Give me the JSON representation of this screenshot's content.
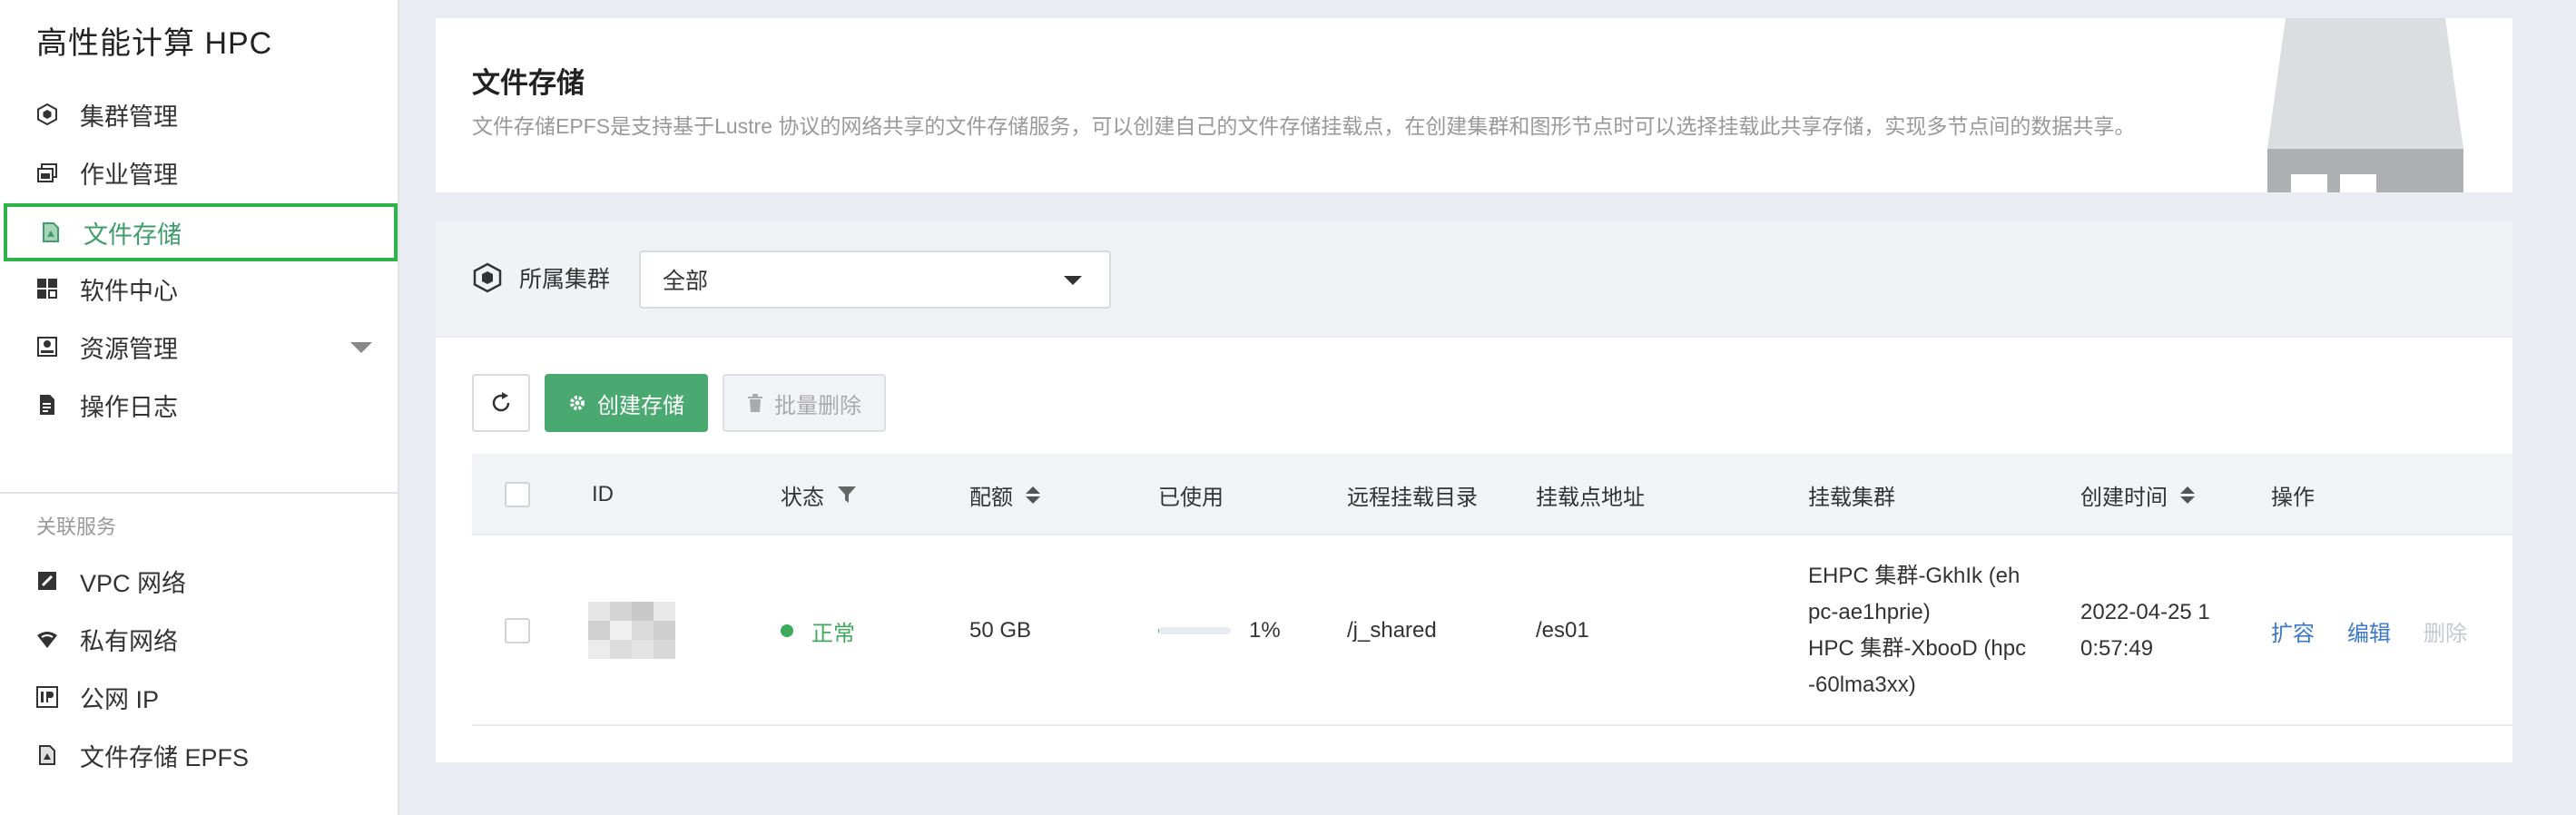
{
  "sidebar": {
    "brand": "高性能计算 HPC",
    "items": [
      {
        "label": "集群管理",
        "icon": "cluster-icon"
      },
      {
        "label": "作业管理",
        "icon": "job-icon"
      },
      {
        "label": "文件存储",
        "icon": "file-storage-icon",
        "active": true
      },
      {
        "label": "软件中心",
        "icon": "software-icon"
      },
      {
        "label": "资源管理",
        "icon": "resource-icon",
        "expandable": true
      },
      {
        "label": "操作日志",
        "icon": "log-icon"
      }
    ],
    "section_label": "关联服务",
    "related": [
      {
        "label": "VPC 网络",
        "icon": "vpc-icon"
      },
      {
        "label": "私有网络",
        "icon": "private-network-icon"
      },
      {
        "label": "公网 IP",
        "icon": "public-ip-icon"
      },
      {
        "label": "文件存储 EPFS",
        "icon": "epfs-icon"
      }
    ]
  },
  "header": {
    "title": "文件存储",
    "description": "文件存储EPFS是支持基于Lustre 协议的网络共享的文件存储服务，可以创建自己的文件存储挂载点，在创建集群和图形节点时可以选择挂载此共享存储，实现多节点间的数据共享。"
  },
  "filter": {
    "label": "所属集群",
    "selected": "全部"
  },
  "toolbar": {
    "create_label": "创建存储",
    "batch_delete_label": "批量删除"
  },
  "table": {
    "columns": [
      "ID",
      "状态",
      "配额",
      "已使用",
      "远程挂载目录",
      "挂载点地址",
      "挂载集群",
      "创建时间",
      "操作"
    ],
    "rows": [
      {
        "status": "正常",
        "quota": "50 GB",
        "used_percent": 1,
        "used_label": "1%",
        "remote_dir": "/j_shared",
        "mount_addr": "/es01",
        "clusters": [
          "EHPC 集群-GkhIk (eh",
          "pc-ae1hprie)",
          "HPC 集群-XbooD (hpc",
          "-60lma3xx)"
        ],
        "created": [
          "2022-04-25 1",
          "0:57:49"
        ],
        "actions": {
          "expand": "扩容",
          "edit": "编辑",
          "delete": "删除"
        }
      }
    ]
  },
  "colors": {
    "accent": "#4aa971",
    "active_border": "#2db34a",
    "link": "#3e78c6",
    "status_ok": "#3daa5c"
  }
}
